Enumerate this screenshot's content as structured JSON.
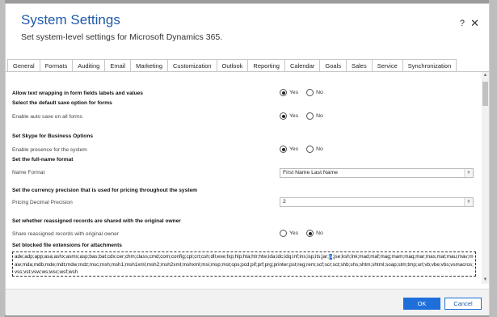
{
  "dialog": {
    "title": "System Settings",
    "subtitle": "Set system-level settings for Microsoft Dynamics 365.",
    "help_label": "?",
    "close_label": "✕"
  },
  "tabs": [
    {
      "label": "General",
      "active": true
    },
    {
      "label": "Formats"
    },
    {
      "label": "Auditing"
    },
    {
      "label": "Email"
    },
    {
      "label": "Marketing"
    },
    {
      "label": "Customization"
    },
    {
      "label": "Outlook"
    },
    {
      "label": "Reporting"
    },
    {
      "label": "Calendar"
    },
    {
      "label": "Goals"
    },
    {
      "label": "Sales"
    },
    {
      "label": "Service"
    },
    {
      "label": "Synchronization"
    }
  ],
  "settings": {
    "wrap_text": {
      "heading": "Allow text wrapping in form fields labels and values",
      "selected": "Yes"
    },
    "save_option": {
      "heading": "Select the default save option for forms",
      "label": "Enable auto save on all forms",
      "selected": "Yes"
    },
    "skype": {
      "heading": "Set Skype for Business Options",
      "label": "Enable presence for the system",
      "selected": "Yes"
    },
    "full_name": {
      "heading": "Set the full-name format",
      "label": "Name Format",
      "value": "First Name Last Name"
    },
    "currency": {
      "heading": "Set the currency precision that is used for pricing throughout the system",
      "label": "Pricing Decimal Precision",
      "value": "2"
    },
    "reassigned": {
      "heading": "Set whether reassigned records are shared with the original owner",
      "label": "Share reassigned records with original owner",
      "selected": "No"
    },
    "blocked": {
      "heading": "Set blocked file extensions for attachments",
      "text_before": "ade;adp;app;asa;ashx;asmx;asp;bas;bat;cdx;cer;chm;class;cmd;com;config;cpl;crt;csh;dll;exe;fxp;hlp;hta;htr;htw;ida;idc;idq;inf;ins;isp;its;jar;",
      "text_selected": "js",
      "text_after": ";jse;ksh;lnk;mad;maf;mag;mam;maq;mar;mas;mat;mau;mav;maw;mda;mdb;mde;mdt;mdw;mdz;msc;msh;msh1;msh1xml;msh2;msh2xml;mshxml;msi;msp;mst;ops;pcd;pif;prf;prg;printer;pst;reg;rem;scf;scr;sct;shb;shs;shtm;shtml;soap;stm;tmp;url;vb;vbe;vbs;vsmacros;vss;vst;vsw;ws;wsc;wsf;wsh"
    }
  },
  "radio": {
    "yes": "Yes",
    "no": "No"
  },
  "footer": {
    "ok_label": "OK",
    "cancel_label": "Cancel"
  },
  "colors": {
    "accent": "#1e6fd9",
    "title": "#1e5aa8"
  }
}
